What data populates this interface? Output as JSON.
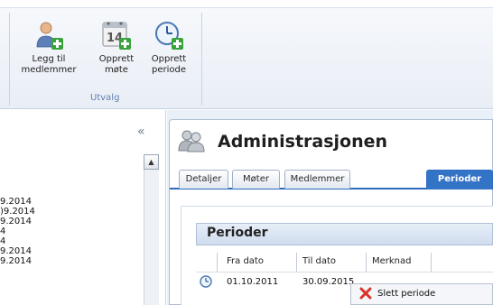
{
  "ribbon": {
    "buttons": [
      {
        "line1": "Legg til",
        "line2": "medlemmer",
        "icon": "add-user-icon"
      },
      {
        "line1": "Opprett",
        "line2": "møte",
        "icon": "calendar-add-icon",
        "calendar_day": "14"
      },
      {
        "line1": "Opprett",
        "line2": "periode",
        "icon": "clock-add-icon"
      }
    ],
    "group_label": "Utvalg"
  },
  "left_panel": {
    "collapse_glyph": "«",
    "scroll_up_glyph": "▲",
    "items": [
      "9.2014",
      ")9.2014",
      "9.2014",
      "4",
      "4",
      "9.2014",
      "9.2014"
    ]
  },
  "main": {
    "title": "Administrasjonen",
    "title_icon": "group-icon",
    "tabs": [
      "Detaljer",
      "Møter",
      "Medlemmer",
      "Perioder"
    ],
    "active_tab": "Perioder"
  },
  "grid": {
    "title": "Perioder",
    "columns": [
      "Fra dato",
      "Til dato",
      "Merknad"
    ],
    "rows": [
      {
        "icon": "clock-icon",
        "fra_dato": "01.10.2011",
        "til_dato": "30.09.2015",
        "merknad": ""
      }
    ]
  },
  "context_menu": {
    "items": [
      {
        "label": "Slett periode",
        "icon": "delete-x-icon"
      }
    ]
  },
  "colors": {
    "accent": "#3474c7",
    "icon_green": "#39a33b",
    "delete_red": "#d9322b"
  }
}
